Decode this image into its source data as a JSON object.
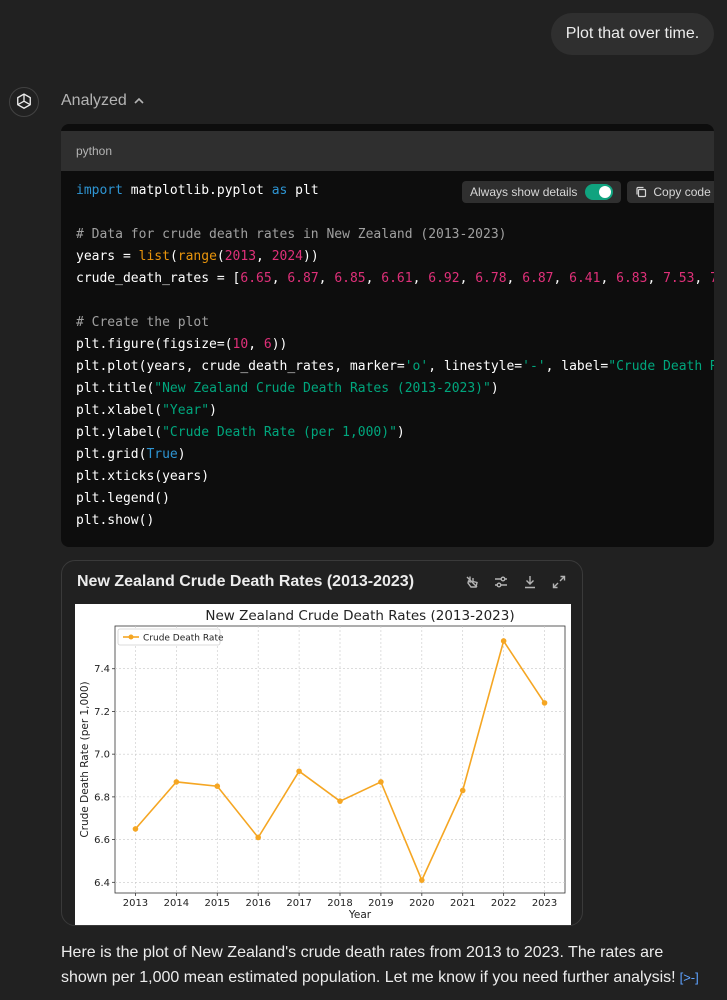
{
  "user_message": "Plot that over time.",
  "analysis": {
    "label": "Analyzed"
  },
  "code_block": {
    "language": "python",
    "always_show_details_label": "Always show details",
    "copy_label": "Copy code",
    "lines": [
      "import matplotlib.pyplot as plt",
      "",
      "# Data for crude death rates in New Zealand (2013-2023)",
      "years = list(range(2013, 2024))",
      "crude_death_rates = [6.65, 6.87, 6.85, 6.61, 6.92, 6.78, 6.87, 6.41, 6.83, 7.53, 7",
      "",
      "# Create the plot",
      "plt.figure(figsize=(10, 6))",
      "plt.plot(years, crude_death_rates, marker='o', linestyle='-', label=\"Crude Death Ra",
      "plt.title(\"New Zealand Crude Death Rates (2013-2023)\")",
      "plt.xlabel(\"Year\")",
      "plt.ylabel(\"Crude Death Rate (per 1,000)\")",
      "plt.grid(True)",
      "plt.xticks(years)",
      "plt.legend()",
      "plt.show()"
    ]
  },
  "chart_card": {
    "title": "New Zealand Crude Death Rates (2013-2023)"
  },
  "chart_data": {
    "type": "line",
    "title": "New Zealand Crude Death Rates (2013-2023)",
    "xlabel": "Year",
    "ylabel": "Crude Death Rate (per 1,000)",
    "x": [
      2013,
      2014,
      2015,
      2016,
      2017,
      2018,
      2019,
      2020,
      2021,
      2022,
      2023
    ],
    "series": [
      {
        "name": "Crude Death Rate",
        "values": [
          6.65,
          6.87,
          6.85,
          6.61,
          6.92,
          6.78,
          6.87,
          6.41,
          6.83,
          7.53,
          7.24
        ],
        "color": "#f5a623"
      }
    ],
    "yticks": [
      6.4,
      6.6,
      6.8,
      7.0,
      7.2,
      7.4
    ],
    "ytick_labels": [
      "6.4",
      "6.6",
      "6.8",
      "7.0",
      "7.2",
      "7.4"
    ],
    "ylim": [
      6.35,
      7.6
    ],
    "grid": true,
    "legend_position": "top-left"
  },
  "answer": {
    "text": "Here is the plot of New Zealand's crude death rates from 2013 to 2023. The rates are shown per 1,000 mean estimated population. Let me know if you need further analysis!",
    "citation_label": "[>-]"
  }
}
